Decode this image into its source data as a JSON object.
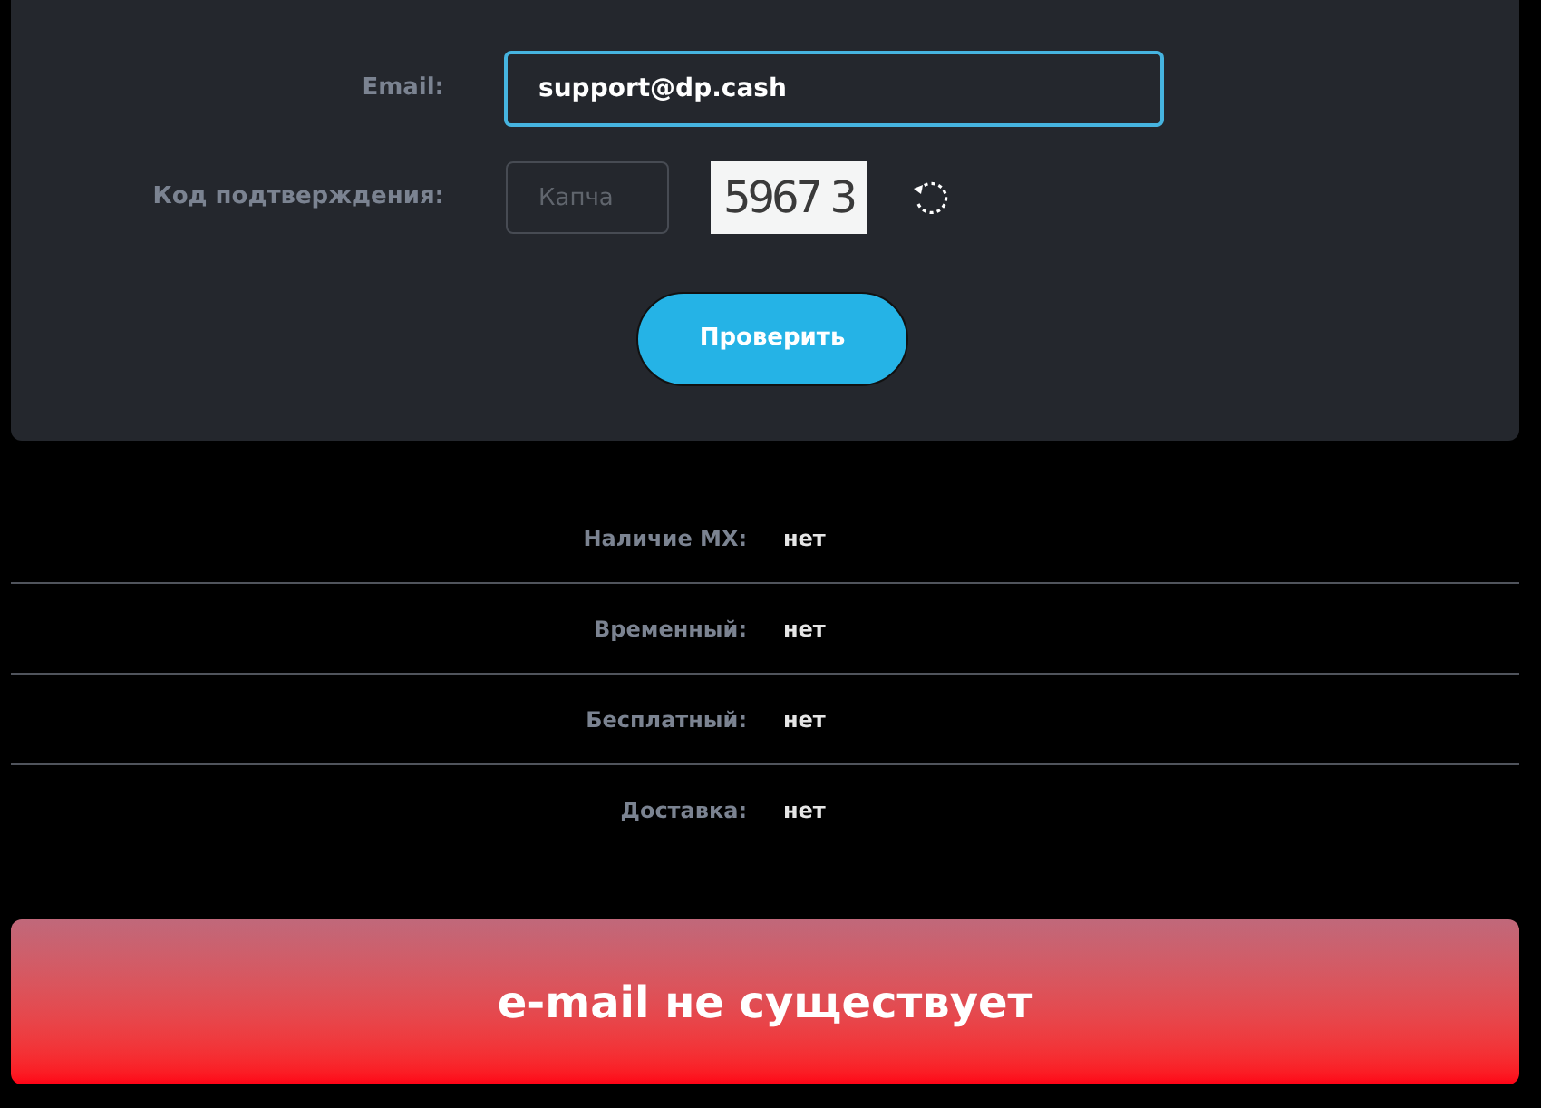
{
  "form": {
    "email": {
      "label": "Email:",
      "value": "support@dp.cash",
      "focused": true
    },
    "captcha": {
      "label": "Код подтверждения:",
      "placeholder": "Капча",
      "image_text": "5967 3"
    },
    "submit": "Проверить"
  },
  "results": [
    {
      "label": "Наличие MX:",
      "value": "нет"
    },
    {
      "label": "Временный:",
      "value": "нет"
    },
    {
      "label": "Бесплатный:",
      "value": "нет"
    },
    {
      "label": "Доставка:",
      "value": "нет"
    }
  ],
  "verdict": {
    "text": "e-mail не существует",
    "kind": "error"
  }
}
